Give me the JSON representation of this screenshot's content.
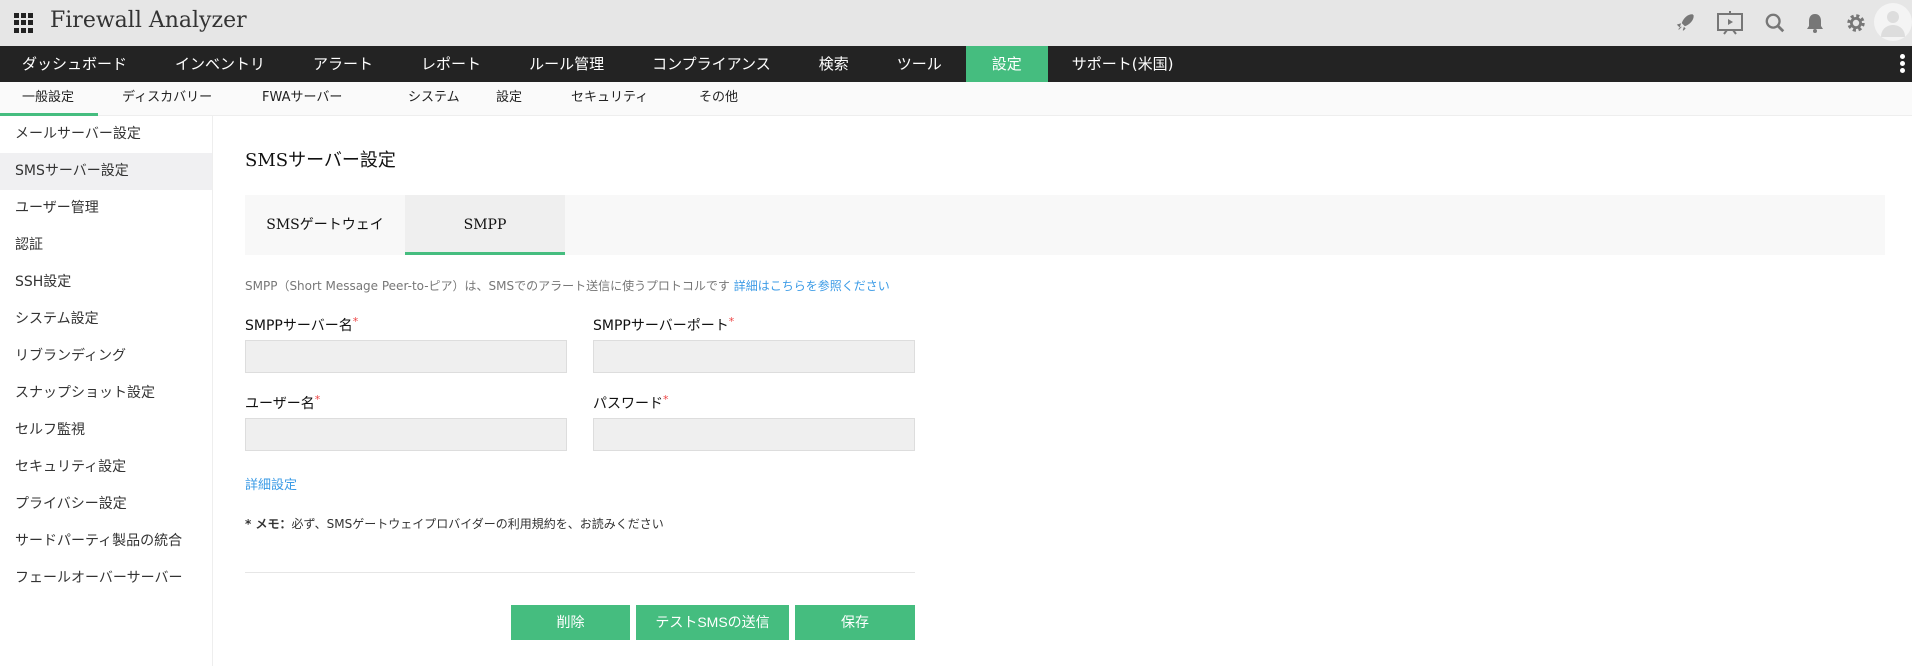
{
  "header": {
    "app_title": "Firewall Analyzer",
    "icons": [
      "apps-icon",
      "rocket-icon",
      "presentation-icon",
      "search-icon",
      "bell-icon",
      "gear-icon",
      "avatar"
    ]
  },
  "nav": {
    "items": [
      "ダッシュボード",
      "インベントリ",
      "アラート",
      "レポート",
      "ルール管理",
      "コンプライアンス",
      "検索",
      "ツール",
      "設定",
      "サポート(米国)"
    ],
    "active": "設定"
  },
  "subnav": {
    "items": [
      "一般設定",
      "ディスカバリー",
      "FWAサーバー",
      "システム",
      "設定",
      "セキュリティ",
      "その他"
    ],
    "active": "一般設定"
  },
  "sidebar": {
    "items": [
      "メールサーバー設定",
      "SMSサーバー設定",
      "ユーザー管理",
      "認証",
      "SSH設定",
      "システム設定",
      "リブランディング",
      "スナップショット設定",
      "セルフ監視",
      "セキュリティ設定",
      "プライバシー設定",
      "サードパーティ製品の統合",
      "フェールオーバーサーバー"
    ],
    "active": "SMSサーバー設定"
  },
  "main": {
    "title": "SMSサーバー設定",
    "tabs": [
      "SMSゲートウェイ",
      "SMPP"
    ],
    "active_tab": "SMPP",
    "description": "SMPP（Short Message Peer-to-ピア）は、SMSでのアラート送信に使うプロトコルです",
    "description_link": "詳細はこちらを参照ください",
    "fields": {
      "server_name": {
        "label": "SMPPサーバー名",
        "value": ""
      },
      "server_port": {
        "label": "SMPPサーバーポート",
        "value": ""
      },
      "username": {
        "label": "ユーザー名",
        "value": ""
      },
      "password": {
        "label": "パスワード",
        "value": ""
      }
    },
    "required_mark": "*",
    "advanced_link": "詳細設定",
    "memo_prefix": "* メモ：",
    "memo_text": "必ず、SMSゲートウェイプロバイダーの利用規約を、お読みください",
    "buttons": {
      "delete": "削除",
      "test": "テストSMSの送信",
      "save": "保存"
    }
  },
  "colors": {
    "accent": "#45bd7f",
    "nav_bg": "#232323",
    "link": "#3b9be6"
  }
}
